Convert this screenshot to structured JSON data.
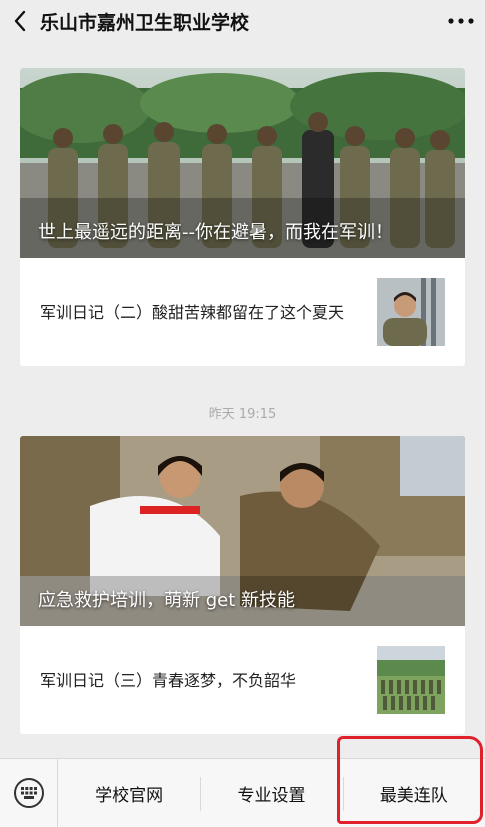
{
  "header": {
    "back_glyph": "〈",
    "title": "乐山市嘉州卫生职业学校",
    "more_glyph": "···"
  },
  "articles_1": {
    "hero_caption": "世上最遥远的距离--你在避暑，而我在军训！",
    "row_title": "军训日记（二）酸甜苦辣都留在了这个夏天"
  },
  "timestamp": "昨天 19:15",
  "articles_2": {
    "hero_caption": "应急救护培训，萌新 get 新技能",
    "row_title": "军训日记（三）青春逐梦，不负韶华"
  },
  "menu": {
    "items": [
      {
        "label": "学校官网"
      },
      {
        "label": "专业设置"
      },
      {
        "label": "最美连队"
      }
    ]
  },
  "icons": {
    "back": "back-arrow-icon",
    "more": "more-dots-icon",
    "keyboard": "keyboard-icon"
  },
  "colors": {
    "background": "#ededed",
    "annotation_red": "#e0202a"
  }
}
